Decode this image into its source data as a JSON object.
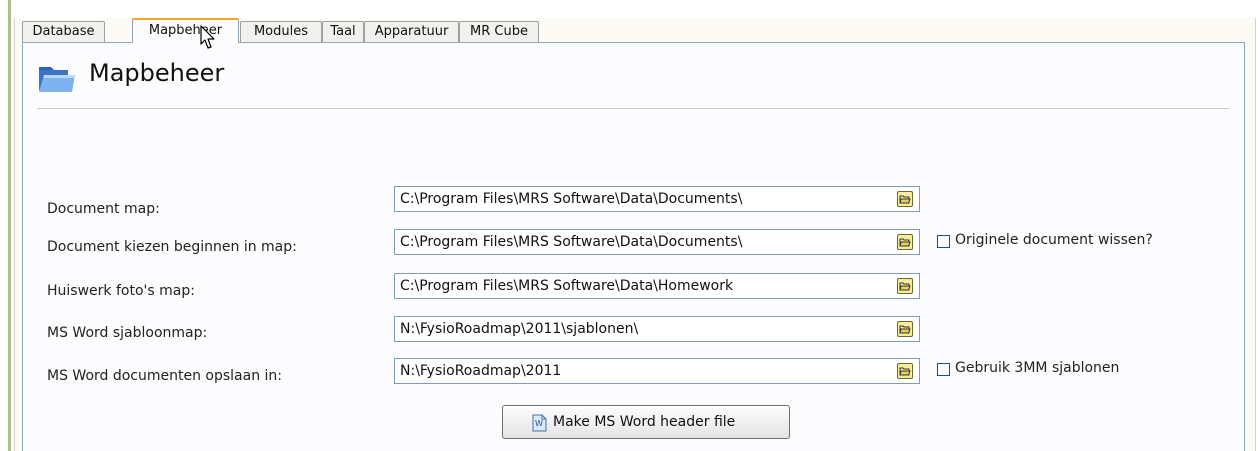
{
  "tabs": [
    {
      "label": "Database"
    },
    {
      "label": "Mapbeheer",
      "active": true
    },
    {
      "label": "Modules"
    },
    {
      "label": "Taal"
    },
    {
      "label": "Apparatuur"
    },
    {
      "label": "MR Cube"
    }
  ],
  "header": {
    "title": "Mapbeheer",
    "icon": "folder-icon"
  },
  "fields": [
    {
      "label": "Document map:",
      "value": "C:\\Program Files\\MRS Software\\Data\\Documents\\"
    },
    {
      "label": "Document kiezen beginnen in map:",
      "value": "C:\\Program Files\\MRS Software\\Data\\Documents\\"
    },
    {
      "label": "Huiswerk foto's map:",
      "value": "C:\\Program Files\\MRS Software\\Data\\Homework"
    },
    {
      "label": "MS Word sjabloonmap:",
      "value": "N:\\FysioRoadmap\\2011\\sjablonen\\"
    },
    {
      "label": "MS Word documenten opslaan in:",
      "value": "N:\\FysioRoadmap\\2011"
    }
  ],
  "options": [
    {
      "label": "Originele document wissen?",
      "checked": false
    },
    {
      "label": "Gebruik 3MM sjablonen",
      "checked": false
    }
  ],
  "actions": {
    "make_header_label": "Make MS Word header file",
    "icon": "word-document-icon"
  },
  "colors": {
    "active_tab_accent": "#f2a51e",
    "input_border": "#7f9db9",
    "browse_button": "#f6ec9a",
    "left_bar": "#a9c08a"
  }
}
